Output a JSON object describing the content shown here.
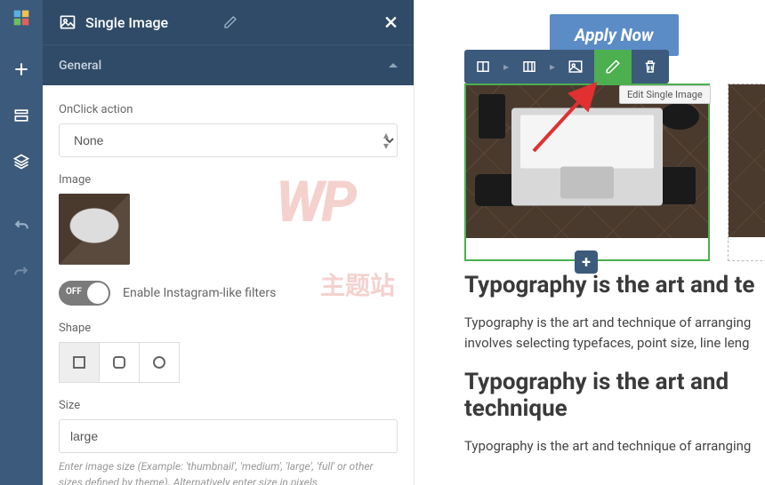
{
  "panel": {
    "title": "Single Image",
    "tab": "General",
    "onclick_label": "OnClick action",
    "onclick_value": "None",
    "image_label": "Image",
    "toggle_off": "OFF",
    "toggle_label": "Enable Instagram-like filters",
    "shape_label": "Shape",
    "size_label": "Size",
    "size_value": "large",
    "size_help": "Enter image size (Example: 'thumbnail', 'medium', 'large', 'full' or other sizes defined by theme). Alternatively enter size in pixels"
  },
  "canvas": {
    "apply": "Apply Now",
    "tooltip": "Edit Single Image",
    "heading1": "Typography is the art and te",
    "para1": "Typography is the art and technique of arranging",
    "para1b": "involves selecting typefaces, point size, line leng",
    "heading2": "Typography is the art and technique",
    "para2": "Typography is the art and technique of arranging"
  },
  "watermark": {
    "main": "WP",
    "sub": "主题站"
  }
}
